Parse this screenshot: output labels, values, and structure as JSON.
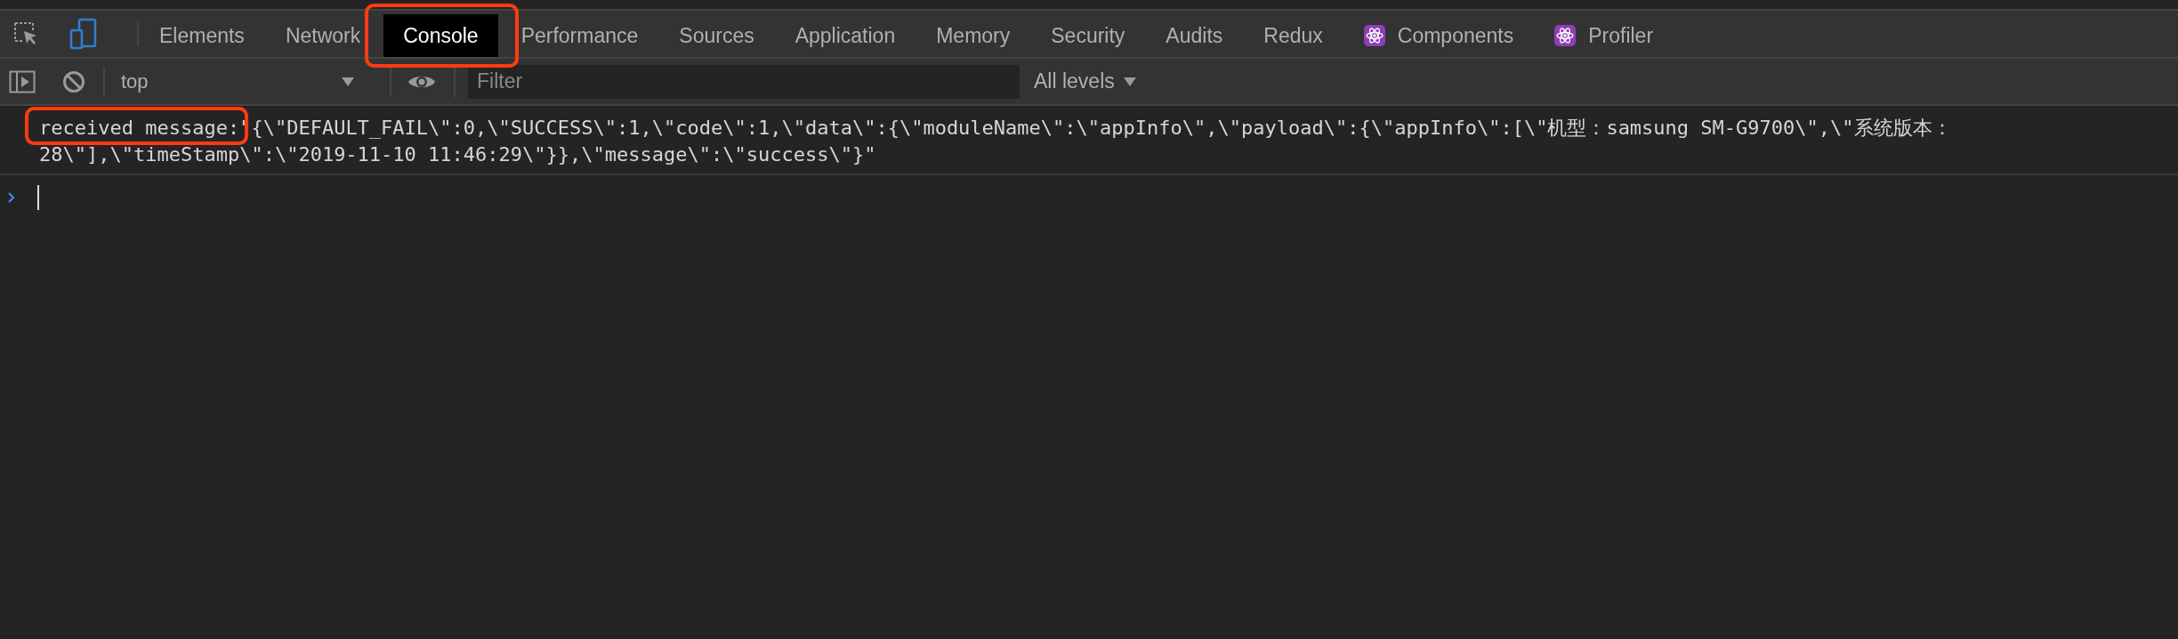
{
  "tabs": [
    {
      "label": "Elements",
      "selected": false,
      "highlighted": false
    },
    {
      "label": "Network",
      "selected": false,
      "highlighted": false
    },
    {
      "label": "Console",
      "selected": true,
      "highlighted": true
    },
    {
      "label": "Performance",
      "selected": false,
      "highlighted": false
    },
    {
      "label": "Sources",
      "selected": false,
      "highlighted": false
    },
    {
      "label": "Application",
      "selected": false,
      "highlighted": false
    },
    {
      "label": "Memory",
      "selected": false,
      "highlighted": false
    },
    {
      "label": "Security",
      "selected": false,
      "highlighted": false
    },
    {
      "label": "Audits",
      "selected": false,
      "highlighted": false
    },
    {
      "label": "Redux",
      "selected": false,
      "highlighted": false
    },
    {
      "label": "Components",
      "kind": "react",
      "selected": false,
      "highlighted": false
    },
    {
      "label": "Profiler",
      "kind": "react",
      "selected": false,
      "highlighted": false
    }
  ],
  "toolbar": {
    "context": "top",
    "filter": {
      "placeholder": "Filter"
    },
    "levels": "All levels"
  },
  "messages": [
    {
      "prefix": "received message:",
      "highlighted": true,
      "lines": [
        "\"{\\\"DEFAULT_FAIL\\\":0,\\\"SUCCESS\\\":1,\\\"code\\\":1,\\\"data\\\":{\\\"moduleName\\\":\\\"appInfo\\\",\\\"payload\\\":{\\\"appInfo\\\":[\\\"机型：samsung SM-G9700\\\",\\\"系统版本：",
        "28\\\"],\\\"timeStamp\\\":\\\"2019-11-10 11:46:29\\\"}},\\\"message\\\":\\\"success\\\"}\""
      ]
    }
  ]
}
